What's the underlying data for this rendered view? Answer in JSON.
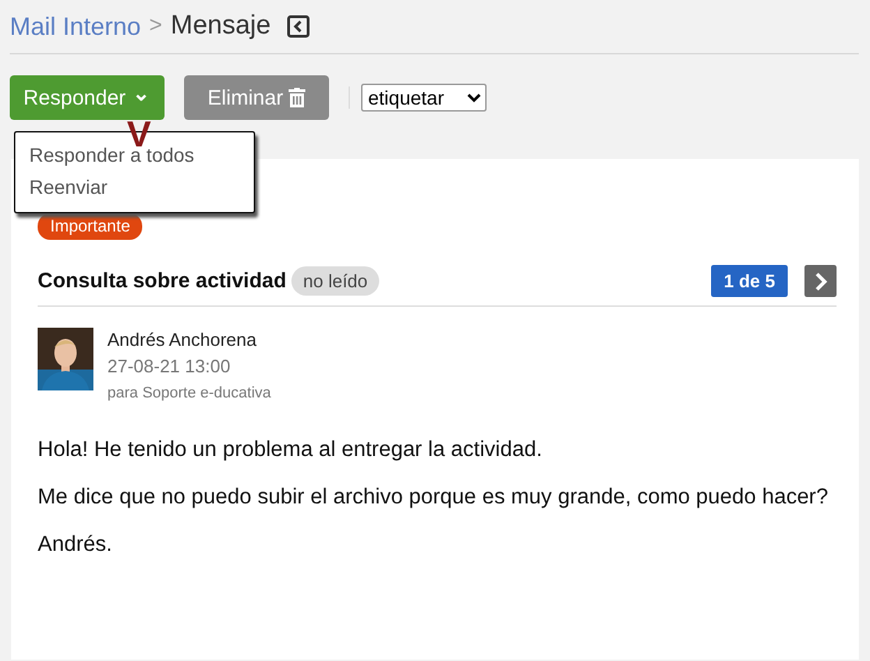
{
  "breadcrumb": {
    "parent": "Mail Interno",
    "separator": ">",
    "current": "Mensaje"
  },
  "toolbar": {
    "reply_button": {
      "label": "Responder",
      "caret": "⌄"
    },
    "delete_button": {
      "label": "Eliminar"
    },
    "label_select": {
      "value": "etiquetar"
    }
  },
  "reply_menu": {
    "expanded": true,
    "items": [
      {
        "label": "Responder a todos"
      },
      {
        "label": "Reenviar"
      }
    ]
  },
  "annotation": {
    "mark": "V",
    "color": "#8b1a1a"
  },
  "message": {
    "tag": {
      "label": "Importante",
      "color": "#e0470f"
    },
    "subject": "Consulta sobre actividad",
    "status": "no leído",
    "pager": "1 de 5",
    "sender": "Andrés Anchorena",
    "date": "27-08-21 13:00",
    "recipient": "para Soporte e-ducativa",
    "body": [
      "Hola! He tenido un problema al entregar la actividad.",
      "Me dice que no puedo subir el archivo porque es muy grande, como puedo hacer?",
      "Andrés."
    ]
  }
}
